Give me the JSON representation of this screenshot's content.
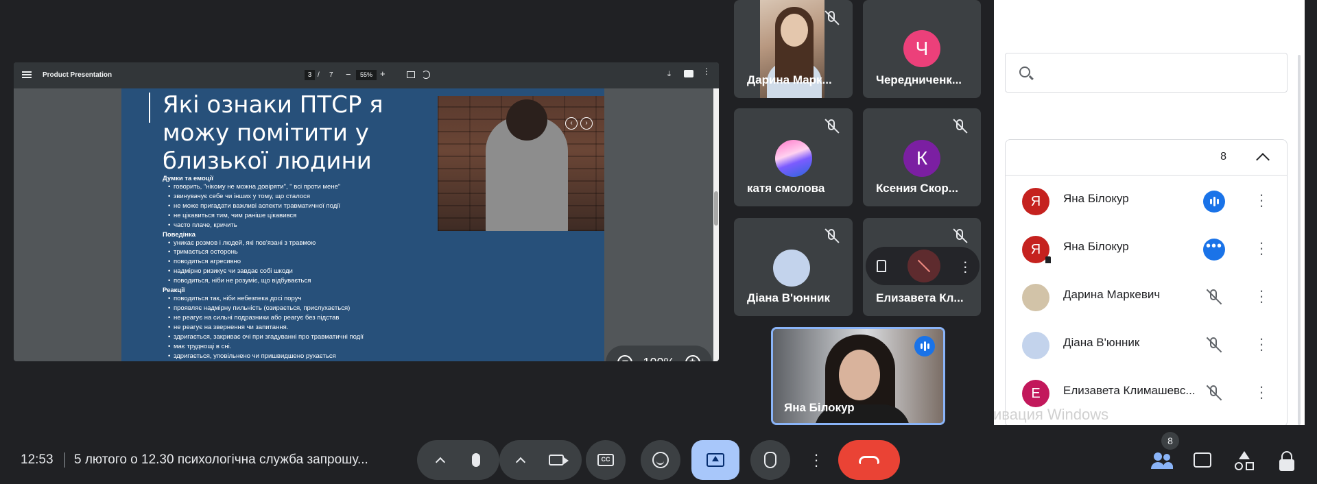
{
  "pdf": {
    "title": "Product Presentation",
    "page_current": "3",
    "page_sep": "/",
    "page_total": "7",
    "zoom_minus": "−",
    "zoom": "55%",
    "zoom_plus": "+",
    "download": "⤓",
    "more": "⋮"
  },
  "slide": {
    "heading": "Які ознаки ПТСР я можу помітити у близької людини",
    "sections": [
      {
        "title": "Думки та емоції",
        "items": [
          "говорить, \"нікому не можна довіряти\", \" всі проти мене\"",
          "звинувачує себе чи інших у тому, що сталося",
          "не може пригадати важливі аспекти травматичної події",
          "не цікавиться тим, чим раніше цікавився",
          "часто плаче, кричить"
        ]
      },
      {
        "title": "Поведінка",
        "items": [
          "уникає розмов і людей, які пов'язані з травмою",
          "тримається осторонь",
          "поводиться агресивно",
          "надмірно ризикує чи завдає собі шкоди",
          "поводиться, ніби не розуміє, що відбувається"
        ]
      },
      {
        "title": "Реакції",
        "items": [
          "поводиться так, ніби небезпека досі поруч",
          "проявляє надмірну пильність (озирається, прислухається)",
          "не реагує на сильні подразники або реагує без підстав",
          "не реагує на звернення чи запитання.",
          "здригається, закриває очі при згадуванні про травматичні події",
          "має труднощі в сні.",
          "здригається, уповільнено чи пришвидшено рухається"
        ]
      }
    ],
    "photo_prev": "‹",
    "photo_next": "›"
  },
  "zoom_pill": {
    "minus": "−",
    "value": "100%",
    "plus": "+"
  },
  "tiles": {
    "darina": "Дарина Марк...",
    "cherednichenko": "Чередниченк...",
    "cherednichenko_initial": "Ч",
    "katya": "катя смолова",
    "ksenia": "Ксения Скор...",
    "ksenia_initial": "К",
    "diana": "Діана В'юнник",
    "elyzaveta": "Елизавета Кл...",
    "self": "Яна Білокур"
  },
  "panel": {
    "section_count": "8",
    "people": [
      {
        "name": "Яна Білокур",
        "initial": "Я",
        "color": "#c5221f"
      },
      {
        "name": "Яна Білокур",
        "initial": "Я",
        "color": "#c5221f"
      },
      {
        "name": "Дарина Маркевич",
        "initial": "",
        "color": "#d2c3a8"
      },
      {
        "name": "Діана В'юнник",
        "initial": "",
        "color": "#c3d3ec"
      },
      {
        "name": "Елизавета Климашевс...",
        "initial": "E",
        "color": "#c2185b"
      }
    ],
    "watermark": "ивация Windows"
  },
  "bottom": {
    "time": "12:53",
    "meeting_title": "5 лютого о 12.30 психологічна служба запрошу...",
    "cc_label": "CC",
    "people_badge": "8"
  },
  "colors": {
    "bg": "#202124",
    "tile": "#3c4043",
    "accent": "#8ab4f8",
    "end": "#ea4335",
    "slide": "#27507a"
  }
}
